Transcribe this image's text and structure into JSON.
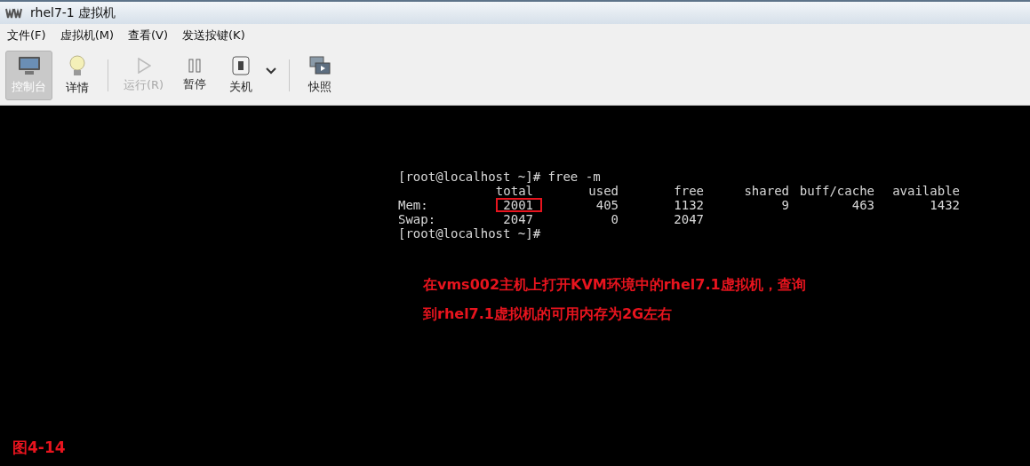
{
  "window": {
    "title": "rhel7-1 虚拟机"
  },
  "menu": [
    "文件(F)",
    "虚拟机(M)",
    "查看(V)",
    "发送按键(K)"
  ],
  "toolbar": [
    {
      "kind": "console",
      "label": "控制台",
      "selected": true,
      "disabled": false
    },
    {
      "kind": "details",
      "label": "详情",
      "selected": false,
      "disabled": false
    },
    {
      "kind": "separator"
    },
    {
      "kind": "run",
      "label": "运行(R)",
      "selected": false,
      "disabled": true
    },
    {
      "kind": "pause",
      "label": "暂停",
      "selected": false,
      "disabled": false
    },
    {
      "kind": "shutdown",
      "label": "关机",
      "selected": false,
      "disabled": false
    },
    {
      "kind": "dropdown"
    },
    {
      "kind": "separator"
    },
    {
      "kind": "snapshot",
      "label": "快照",
      "selected": false,
      "disabled": false
    }
  ],
  "terminal": {
    "command": "[root@localhost ~]# free -m",
    "columns": [
      "total",
      "used",
      "free",
      "shared",
      "buff/cache",
      "available"
    ],
    "rows": [
      {
        "label": "Mem:",
        "values": [
          {
            "text": "2001",
            "highlighted": true
          },
          {
            "text": "405",
            "highlighted": false
          },
          {
            "text": "1132",
            "highlighted": false
          },
          {
            "text": "9",
            "highlighted": false
          },
          {
            "text": "463",
            "highlighted": false
          },
          {
            "text": "1432",
            "highlighted": false
          }
        ]
      },
      {
        "label": "Swap:",
        "values": [
          {
            "text": "2047",
            "highlighted": false
          },
          {
            "text": "0",
            "highlighted": false
          },
          {
            "text": "2047",
            "highlighted": false
          }
        ]
      }
    ],
    "prompt": "[root@localhost ~]#"
  },
  "annotation": {
    "lines": [
      "在vms002主机上打开KVM环境中的rhel7.1虚拟机，查询",
      "到rhel7.1虚拟机的可用内存为2G左右"
    ]
  },
  "figure_label": "图4-14"
}
